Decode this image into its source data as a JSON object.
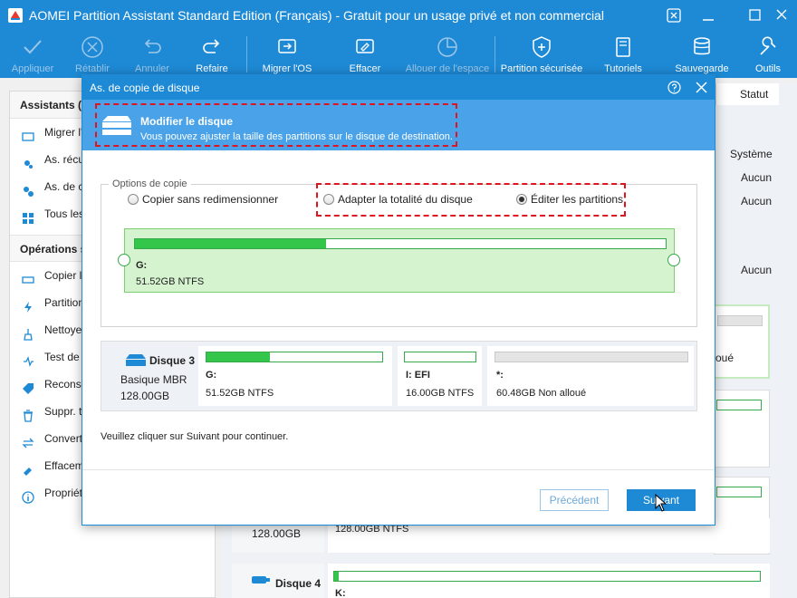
{
  "window": {
    "title": "AOMEI Partition Assistant Standard Edition (Français) - Gratuit pour un usage privé et non commercial",
    "icons": [
      "app-icon",
      "refresh-icon",
      "minimize-icon",
      "maximize-icon",
      "close-icon"
    ]
  },
  "toolbar": {
    "apply": "Appliquer",
    "redo": "Rétablir",
    "undo": "Annuler",
    "refresh": "Refaire",
    "migrate_os": "Migrer l'OS",
    "wipe": "Effacer",
    "allocate_space": "Allouer de l'espace",
    "secure_partition": "Partition sécurisée",
    "tutorials": "Tutoriels",
    "backup": "Sauvegarde",
    "tools": "Outils"
  },
  "left_panel": {
    "wizards_title": "Assistants (",
    "wizards": [
      "Migrer l'O",
      "As. récu",
      "As. de c",
      "Tous les"
    ],
    "ops_title": "Opérations s",
    "ops": [
      "Copier le",
      "Partition",
      "Nettoyer",
      "Test de s",
      "Reconst",
      "Suppr. t",
      "Converti",
      "Effaceme",
      "Propriété"
    ]
  },
  "background": {
    "status_header": "Statut",
    "status_values": [
      "Système",
      "Aucun",
      "Aucun",
      "Aucun"
    ],
    "unalloc_fragment": "oué",
    "disk_size": "128.00GB",
    "part_size": "128.00GB NTFS",
    "disk4": "Disque 4",
    "k_label": "K:"
  },
  "dialog": {
    "title": "As. de copie de disque",
    "banner_title": "Modifier le disque",
    "banner_sub": "Vous pouvez ajuster la taille des partitions sur le disque de destination.",
    "options_legend": "Options de copie",
    "option_no_resize": "Copier sans redimensionner",
    "option_fit": "Adapter la totalité du disque",
    "option_edit": "Éditer les partitions",
    "selected_option": "Éditer les partitions",
    "partition_label": "G:",
    "partition_info": "51.52GB NTFS",
    "partition_used_fraction": 0.36,
    "disk_name": "Disque 3",
    "disk_type": "Basique MBR",
    "disk_size": "128.00GB",
    "segments": [
      {
        "label": "G:",
        "info": "51.52GB NTFS",
        "fill": 0.36
      },
      {
        "label": "I: EFI",
        "info": "16.00GB NTFS",
        "fill": 0.0
      },
      {
        "label": "*:",
        "info": "60.48GB Non alloué",
        "fill": 0.0
      }
    ],
    "hint": "Veuillez cliquer sur Suivant pour continuer.",
    "prev_button": "Précédent",
    "next_button": "Suivant"
  },
  "colors": {
    "accent": "#1e8ad6",
    "banner": "#4aa3e9",
    "green": "#34c54b",
    "highlight": "#e0141e"
  }
}
